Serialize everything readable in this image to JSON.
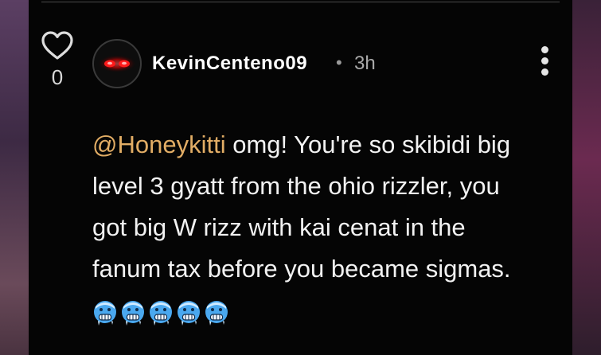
{
  "colors": {
    "card_background": "#050505",
    "mention": "#e2ad65",
    "text": "#f2f2f2",
    "muted": "#aaaaaa"
  },
  "comment": {
    "vote_count": "0",
    "username": "KevinCenteno09",
    "separator": "•",
    "time": "3h",
    "mention": "@Honeykitti",
    "body_line1": " omg! You're so skibidi big",
    "body_line2": "level 3 gyatt from the ohio rizzler, you",
    "body_line3": "got big W rizz with kai cenat in the",
    "body_line4": "fanum tax before you became sigmas.",
    "emojis": [
      "cold-face",
      "cold-face",
      "cold-face",
      "cold-face",
      "cold-face"
    ]
  },
  "icons": {
    "heart": "heart-outline-icon",
    "more": "vertical-ellipsis-icon",
    "avatar": "red-glowing-eyes-avatar"
  }
}
